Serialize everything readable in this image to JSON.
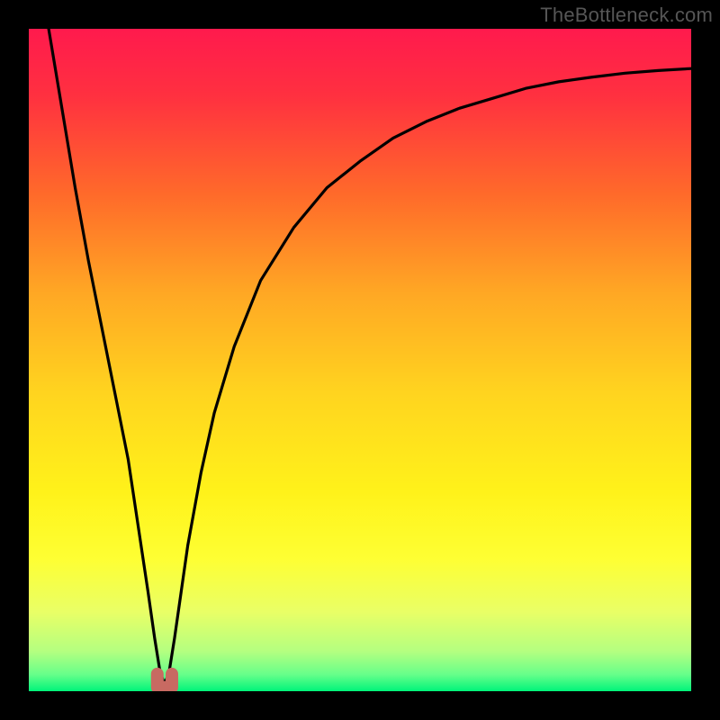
{
  "watermark": "TheBottleneck.com",
  "colors": {
    "black": "#000000",
    "curve": "#000000",
    "marker": "#c86a62",
    "gradient_stops": [
      {
        "offset": 0.0,
        "color": "#ff1a4d"
      },
      {
        "offset": 0.1,
        "color": "#ff3040"
      },
      {
        "offset": 0.25,
        "color": "#ff6a2a"
      },
      {
        "offset": 0.4,
        "color": "#ffa824"
      },
      {
        "offset": 0.55,
        "color": "#ffd41f"
      },
      {
        "offset": 0.7,
        "color": "#fff21a"
      },
      {
        "offset": 0.8,
        "color": "#feff33"
      },
      {
        "offset": 0.88,
        "color": "#e9ff66"
      },
      {
        "offset": 0.94,
        "color": "#b4ff80"
      },
      {
        "offset": 0.975,
        "color": "#66ff8a"
      },
      {
        "offset": 1.0,
        "color": "#00f47a"
      }
    ]
  },
  "chart_data": {
    "type": "line",
    "title": "",
    "xlabel": "",
    "ylabel": "",
    "xlim": [
      0,
      100
    ],
    "ylim": [
      0,
      100
    ],
    "grid": false,
    "legend": false,
    "series": [
      {
        "name": "curve",
        "x": [
          3,
          5,
          7,
          9,
          11,
          13,
          15,
          16.5,
          18,
          19,
          19.8,
          20.5,
          21.2,
          22,
          23,
          24,
          26,
          28,
          31,
          35,
          40,
          45,
          50,
          55,
          60,
          65,
          70,
          75,
          80,
          85,
          90,
          95,
          100
        ],
        "y": [
          100,
          88,
          76,
          65,
          55,
          45,
          35,
          25,
          15,
          8,
          3,
          1,
          3,
          8,
          15,
          22,
          33,
          42,
          52,
          62,
          70,
          76,
          80,
          83.5,
          86,
          88,
          89.5,
          91,
          92,
          92.7,
          93.3,
          93.7,
          94
        ]
      }
    ],
    "marker": {
      "shape": "u",
      "x_center": 20.5,
      "x_half_width": 1.1,
      "y_bottom": 0.6,
      "y_top": 2.6
    }
  }
}
